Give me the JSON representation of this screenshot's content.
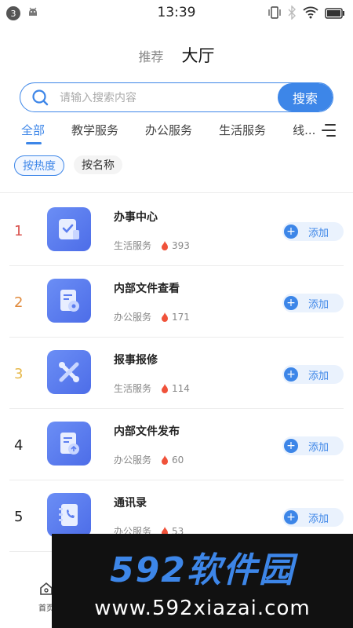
{
  "status_bar": {
    "badge": "3",
    "time": "13:39"
  },
  "header": {
    "tab_recommend": "推荐",
    "tab_hall": "大厅"
  },
  "search": {
    "placeholder": "请输入搜索内容",
    "button_label": "搜索"
  },
  "categories": [
    {
      "label": "全部",
      "active": true
    },
    {
      "label": "教学服务"
    },
    {
      "label": "办公服务"
    },
    {
      "label": "生活服务"
    },
    {
      "label": "线..."
    }
  ],
  "sort": {
    "by_heat": "按热度",
    "by_name": "按名称"
  },
  "apps": [
    {
      "rank": "1",
      "rank_color": "#d9534f",
      "name": "办事中心",
      "category": "生活服务",
      "heat": "393",
      "add_label": "添加"
    },
    {
      "rank": "2",
      "rank_color": "#e08a3c",
      "name": "内部文件查看",
      "category": "办公服务",
      "heat": "171",
      "add_label": "添加"
    },
    {
      "rank": "3",
      "rank_color": "#e6b84a",
      "name": "报事报修",
      "category": "生活服务",
      "heat": "114",
      "add_label": "添加"
    },
    {
      "rank": "4",
      "rank_color": "#222222",
      "name": "内部文件发布",
      "category": "办公服务",
      "heat": "60",
      "add_label": "添加"
    },
    {
      "rank": "5",
      "rank_color": "#222222",
      "name": "通讯录",
      "category": "办公服务",
      "heat": "53",
      "add_label": "添加"
    }
  ],
  "bottom_nav": {
    "home_label": "首页"
  },
  "watermark": {
    "logo": "592软件园",
    "url": "www.592xiazai.com"
  },
  "colors": {
    "accent": "#3d86e8",
    "icon_bg": "#5c7ef0",
    "heat": "#f0523a"
  }
}
